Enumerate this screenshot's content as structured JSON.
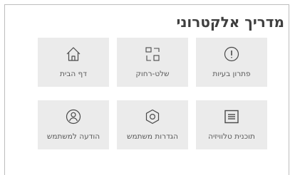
{
  "header": {
    "title": "מדריך אלקטרוני"
  },
  "tiles": [
    {
      "label": "פתרון בעיות",
      "icon": "info-circle-icon"
    },
    {
      "label": "שלט-רחוק",
      "icon": "remote-control-icon"
    },
    {
      "label": "דף הבית",
      "icon": "home-icon"
    },
    {
      "label": "תוכנית טלוויזיה",
      "icon": "tv-guide-icon"
    },
    {
      "label": "הגדרות משתמש",
      "icon": "hexagon-settings-icon"
    },
    {
      "label": "הודעה למשתמש",
      "icon": "user-icon"
    }
  ],
  "colors": {
    "tile_background": "#ebebeb",
    "title_text": "#3f3f3f",
    "label_text": "#5a5a5a",
    "icon_stroke": "#4a4a4a"
  }
}
